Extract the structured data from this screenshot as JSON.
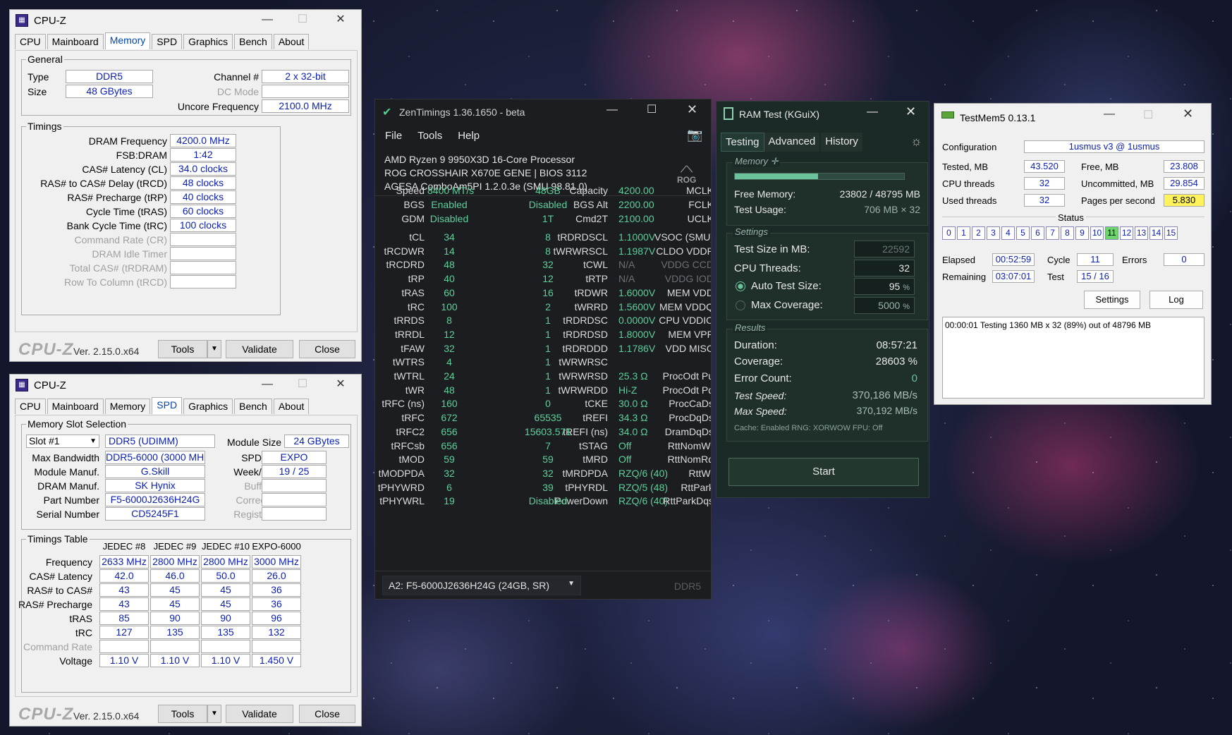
{
  "cpuz_top": {
    "title": "CPU-Z",
    "tabs": [
      "CPU",
      "Mainboard",
      "Memory",
      "SPD",
      "Graphics",
      "Bench",
      "About"
    ],
    "general": {
      "label": "General",
      "type_label": "Type",
      "type": "DDR5",
      "size_label": "Size",
      "size": "48 GBytes",
      "channel_label": "Channel #",
      "channel": "2 x 32-bit",
      "dcmode_label": "DC Mode",
      "uncore_label": "Uncore Frequency",
      "uncore": "2100.0 MHz"
    },
    "timings": {
      "label": "Timings",
      "rows": [
        {
          "l": "DRAM Frequency",
          "v": "4200.0 MHz"
        },
        {
          "l": "FSB:DRAM",
          "v": "1:42"
        },
        {
          "l": "CAS# Latency (CL)",
          "v": "34.0 clocks"
        },
        {
          "l": "RAS# to CAS# Delay (tRCD)",
          "v": "48 clocks"
        },
        {
          "l": "RAS# Precharge (tRP)",
          "v": "40 clocks"
        },
        {
          "l": "Cycle Time (tRAS)",
          "v": "60 clocks"
        },
        {
          "l": "Bank Cycle Time (tRC)",
          "v": "100 clocks"
        },
        {
          "l": "Command Rate (CR)",
          "v": ""
        },
        {
          "l": "DRAM Idle Timer",
          "v": ""
        },
        {
          "l": "Total CAS# (tRDRAM)",
          "v": ""
        },
        {
          "l": "Row To Column (tRCD)",
          "v": ""
        }
      ]
    },
    "footer": {
      "logo": "CPU-Z",
      "version": "Ver. 2.15.0.x64",
      "tools": "Tools",
      "validate": "Validate",
      "close": "Close"
    }
  },
  "cpuz_bottom": {
    "title": "CPU-Z",
    "slot": {
      "label": "Memory Slot Selection",
      "slot": "Slot #1",
      "type": "DDR5 (UDIMM)",
      "module_size_label": "Module Size",
      "module_size": "24 GBytes",
      "max_bw_label": "Max Bandwidth",
      "max_bw": "DDR5-6000 (3000 MHz)",
      "spd_ext_label": "SPD Ext.",
      "spd_ext": "EXPO",
      "manuf_label": "Module Manuf.",
      "manuf": "G.Skill",
      "week_label": "Week/Year",
      "week": "19 / 25",
      "dram_label": "DRAM Manuf.",
      "dram": "SK Hynix",
      "buffered_label": "Buffered",
      "part_label": "Part Number",
      "part": "F5-6000J2636H24G",
      "correction_label": "Correction",
      "serial_label": "Serial Number",
      "serial": "CD5245F1",
      "registered_label": "Registered"
    },
    "table": {
      "label": "Timings Table",
      "cols": [
        "JEDEC #8",
        "JEDEC #9",
        "JEDEC #10",
        "EXPO-6000"
      ],
      "rows": [
        {
          "l": "Frequency",
          "v": [
            "2633 MHz",
            "2800 MHz",
            "2800 MHz",
            "3000 MHz"
          ]
        },
        {
          "l": "CAS# Latency",
          "v": [
            "42.0",
            "46.0",
            "50.0",
            "26.0"
          ]
        },
        {
          "l": "RAS# to CAS#",
          "v": [
            "43",
            "45",
            "45",
            "36"
          ]
        },
        {
          "l": "RAS# Precharge",
          "v": [
            "43",
            "45",
            "45",
            "36"
          ]
        },
        {
          "l": "tRAS",
          "v": [
            "85",
            "90",
            "90",
            "96"
          ]
        },
        {
          "l": "tRC",
          "v": [
            "127",
            "135",
            "135",
            "132"
          ]
        },
        {
          "l": "Command Rate",
          "v": [
            "",
            "",
            "",
            ""
          ]
        },
        {
          "l": "Voltage",
          "v": [
            "1.10 V",
            "1.10 V",
            "1.10 V",
            "1.450 V"
          ]
        }
      ]
    }
  },
  "zen": {
    "title": "ZenTimings 1.36.1650 - beta",
    "menu": [
      "File",
      "Tools",
      "Help"
    ],
    "cpu": "AMD Ryzen 9 9950X3D 16-Core Processor",
    "board": "ROG CROSSHAIR X670E GENE | BIOS 3112",
    "agesa": "AGESA ComboAm5PI 1.2.0.3e (SMU 98.81.0)",
    "rog": "ROG",
    "top": [
      [
        "Speed",
        "8400 MT/s",
        "Capacity",
        "48GB",
        "MCLK",
        "4200.00"
      ],
      [
        "BGS",
        "Enabled",
        "BGS Alt",
        "Disabled",
        "FCLK",
        "2200.00"
      ],
      [
        "GDM",
        "Disabled",
        "Cmd2T",
        "1T",
        "UCLK",
        "2100.00"
      ]
    ],
    "rows": [
      [
        "tCL",
        "34",
        "tRDRDSCL",
        "8",
        "VSOC (SMU)",
        "1.1000V"
      ],
      [
        "tRCDWR",
        "14",
        "tWRWRSCL",
        "8",
        "CLDO VDDP",
        "1.1987V"
      ],
      [
        "tRCDRD",
        "48",
        "tCWL",
        "32",
        "VDDG CCD",
        "N/A"
      ],
      [
        "tRP",
        "40",
        "tRTP",
        "12",
        "VDDG IOD",
        "N/A"
      ],
      [
        "tRAS",
        "60",
        "tRDWR",
        "16",
        "MEM VDD",
        "1.6000V"
      ],
      [
        "tRC",
        "100",
        "tWRRD",
        "2",
        "MEM VDDQ",
        "1.5600V"
      ],
      [
        "tRRDS",
        "8",
        "tRDRDSC",
        "1",
        "CPU VDDIO",
        "0.0000V"
      ],
      [
        "tRRDL",
        "12",
        "tRDRDSD",
        "1",
        "MEM VPP",
        "1.8000V"
      ],
      [
        "tFAW",
        "32",
        "tRDRDDD",
        "1",
        "VDD MISC",
        "1.1786V"
      ],
      [
        "tWTRS",
        "4",
        "tWRWRSC",
        "1",
        "",
        ""
      ],
      [
        "tWTRL",
        "24",
        "tWRWRSD",
        "1",
        "ProcOdt Pu",
        "25.3 Ω"
      ],
      [
        "tWR",
        "48",
        "tWRWRDD",
        "1",
        "ProcOdt Pd",
        "Hi-Z"
      ],
      [
        "tRFC (ns)",
        "160",
        "tCKE",
        "0",
        "ProcCaDs",
        "30.0 Ω"
      ],
      [
        "tRFC",
        "672",
        "tREFI",
        "65535",
        "ProcDqDs",
        "34.3 Ω"
      ],
      [
        "tRFC2",
        "656",
        "tREFI (ns)",
        "15603.571",
        "DramDqDs",
        "34.0 Ω"
      ],
      [
        "tRFCsb",
        "656",
        "tSTAG",
        "7",
        "RttNomWr",
        "Off"
      ],
      [
        "tMOD",
        "59",
        "tMRD",
        "59",
        "RttNomRd",
        "Off"
      ],
      [
        "tMODPDA",
        "32",
        "tMRDPDA",
        "32",
        "RttWr",
        "RZQ/6 (40)"
      ],
      [
        "tPHYWRD",
        "6",
        "tPHYRDL",
        "39",
        "RttPark",
        "RZQ/5 (48)"
      ],
      [
        "tPHYWRL",
        "19",
        "PowerDown",
        "Disabled",
        "RttParkDqs",
        "RZQ/6 (40)"
      ]
    ],
    "dimm": "A2: F5-6000J2636H24G (24GB, SR)",
    "ddr": "DDR5"
  },
  "ram": {
    "title": "RAM Test (KGuiX)",
    "tabs": [
      "Testing",
      "Advanced",
      "History"
    ],
    "memory_label": "Memory",
    "usage_fraction": 0.49,
    "free_label": "Free Memory:",
    "free": "23802 / 48795 MB",
    "usage_label": "Test Usage:",
    "usage": "706 MB × 32",
    "settings_label": "Settings",
    "size_label": "Test Size in MB:",
    "size": "22592",
    "threads_label": "CPU Threads:",
    "threads": "32",
    "auto_label": "Auto Test Size:",
    "auto": "95",
    "maxcov_label": "Max Coverage:",
    "maxcov": "5000",
    "pct": "%",
    "results_label": "Results",
    "dur_label": "Duration:",
    "dur": "08:57:21",
    "cov_label": "Coverage:",
    "cov": "28603 %",
    "err_label": "Error Count:",
    "err": "0",
    "speed_label": "Test Speed:",
    "speed": "370,186 MB/s",
    "maxspeed_label": "Max Speed:",
    "maxspeed": "370,192 MB/s",
    "footer": "Cache: Enabled  RNG: XORWOW  FPU: Off",
    "start": "Start"
  },
  "tm5": {
    "title": "TestMem5  0.13.1",
    "config_label": "Configuration",
    "config": "1usmus v3 @ 1usmus",
    "tested_label": "Tested, MB",
    "tested": "43.520",
    "free_label": "Free, MB",
    "free": "23.808",
    "cpu_label": "CPU threads",
    "cpu": "32",
    "uncommitted_label": "Uncommitted, MB",
    "uncommitted": "29.854",
    "used_label": "Used threads",
    "used": "32",
    "pages_label": "Pages per second",
    "pages": "5.830",
    "status_label": "Status",
    "status": [
      "0",
      "1",
      "2",
      "3",
      "4",
      "5",
      "6",
      "7",
      "8",
      "9",
      "10",
      "11",
      "12",
      "13",
      "14",
      "15"
    ],
    "elapsed_label": "Elapsed",
    "elapsed": "00:52:59",
    "cycle_label": "Cycle",
    "cycle": "11",
    "errors_label": "Errors",
    "errors": "0",
    "remaining_label": "Remaining",
    "remaining": "03:07:01",
    "test_label": "Test",
    "test": "15 / 16",
    "settings": "Settings",
    "log": "Log",
    "logtext": "00:00:01  Testing 1360 MB x 32 (89%) out of 48796 MB"
  }
}
